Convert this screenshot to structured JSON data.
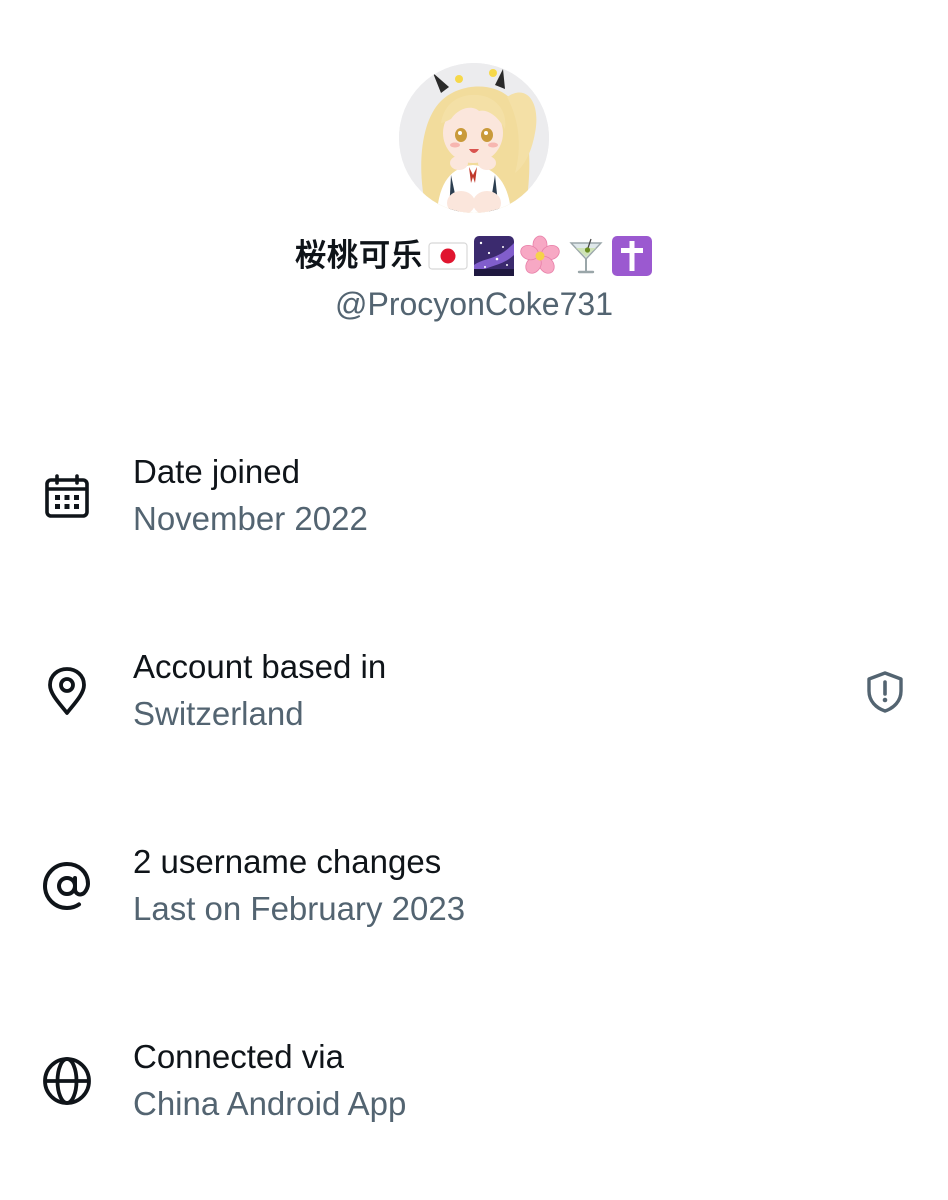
{
  "profile": {
    "display_name": "桜桃可乐",
    "name_emojis": [
      "japan-flag",
      "milky-way",
      "cherry-blossom",
      "cocktail-glass",
      "latin-cross"
    ],
    "handle": "@ProcyonCoke731",
    "avatar": "anime-girl-avatar"
  },
  "about": {
    "rows": [
      {
        "icon": "calendar-icon",
        "title": "Date joined",
        "value": "November 2022"
      },
      {
        "icon": "location-pin-icon",
        "title": "Account based in",
        "value": "Switzerland",
        "trailing_icon": "shield-alert-icon"
      },
      {
        "icon": "at-sign-icon",
        "title": "2 username changes",
        "value": "Last on February 2023"
      },
      {
        "icon": "globe-icon",
        "title": "Connected via",
        "value": "China Android App"
      }
    ]
  },
  "colors": {
    "primary_text": "#0f1419",
    "secondary_text": "#536471",
    "background": "#ffffff"
  }
}
